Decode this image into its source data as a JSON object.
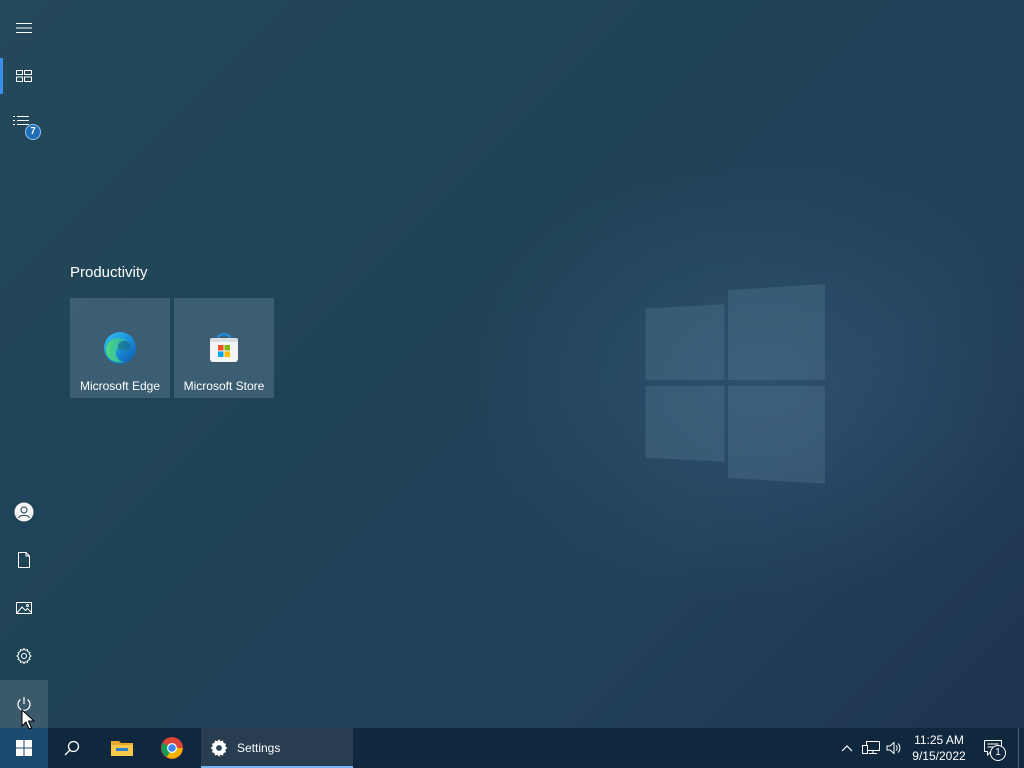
{
  "rail": {
    "items": [
      {
        "name": "expand",
        "icon": "hamburger-icon"
      },
      {
        "name": "pinned",
        "icon": "tiles-icon"
      },
      {
        "name": "all-apps",
        "icon": "list-icon",
        "badge": "7"
      },
      {
        "name": "account",
        "icon": "user-icon"
      },
      {
        "name": "documents",
        "icon": "document-icon"
      },
      {
        "name": "pictures",
        "icon": "pictures-icon"
      },
      {
        "name": "settings",
        "icon": "gear-icon"
      },
      {
        "name": "power",
        "icon": "power-icon"
      }
    ]
  },
  "tiles": {
    "group_title": "Productivity",
    "items": [
      {
        "label": "Microsoft Edge",
        "icon": "edge-icon"
      },
      {
        "label": "Microsoft Store",
        "icon": "store-icon"
      }
    ]
  },
  "taskbar": {
    "apps": [
      {
        "name": "start",
        "icon": "windows-logo-icon"
      },
      {
        "name": "search",
        "icon": "search-icon"
      },
      {
        "name": "file-explorer",
        "icon": "folder-icon"
      },
      {
        "name": "chrome",
        "icon": "chrome-icon"
      },
      {
        "name": "settings",
        "icon": "gear-icon",
        "label": "Settings"
      }
    ],
    "tray": {
      "time": "11:25 AM",
      "date": "9/15/2022",
      "notification_count": "1"
    }
  },
  "colors": {
    "accent": "#3a8ee6",
    "taskbar": "#10283d",
    "start_button": "#1d4a70"
  }
}
